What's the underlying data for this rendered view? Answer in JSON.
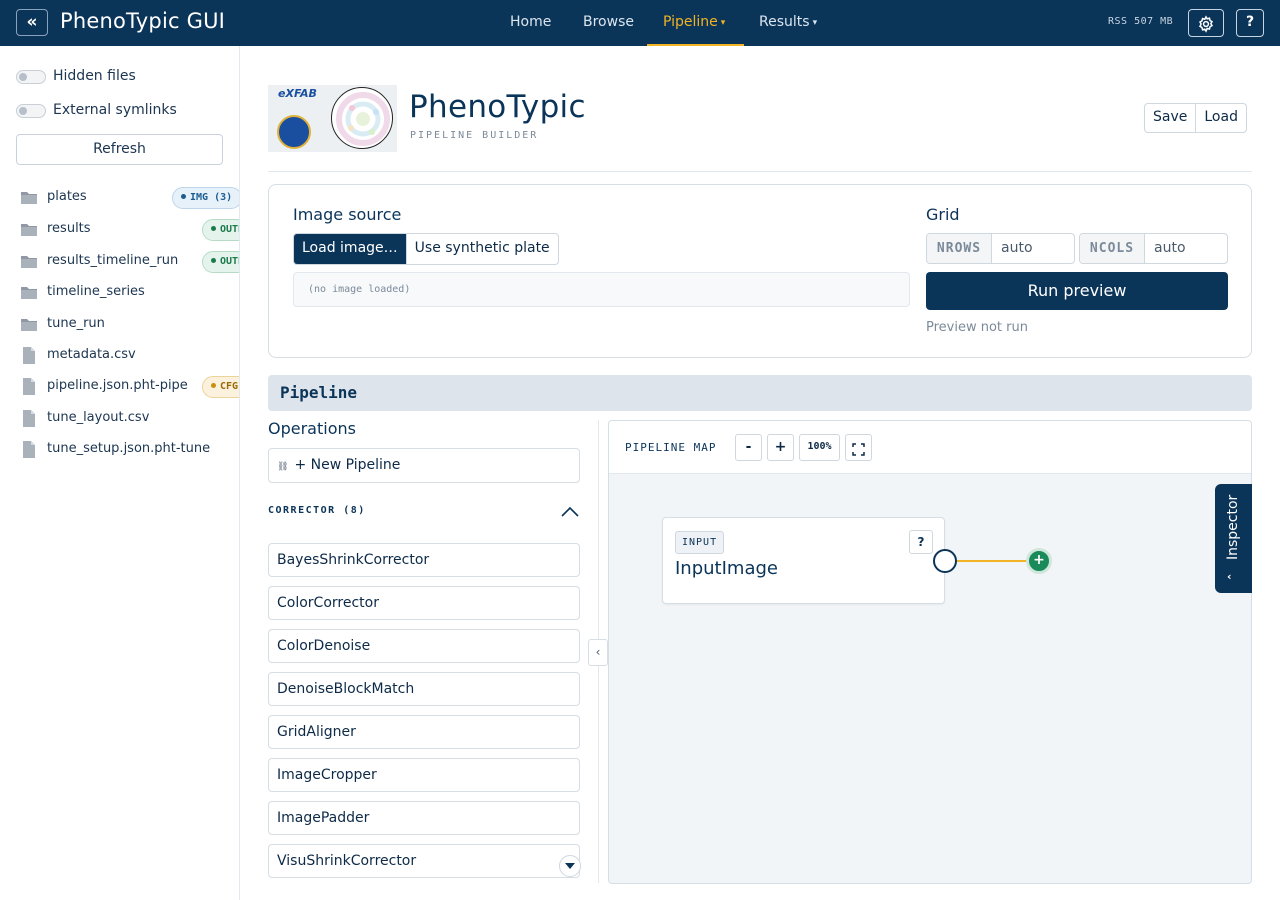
{
  "nav": {
    "app_title": "PhenoTypic GUI",
    "collapse_glyph": "«",
    "items": [
      {
        "label": "Home",
        "active": false,
        "dropdown": false
      },
      {
        "label": "Browse",
        "active": false,
        "dropdown": false
      },
      {
        "label": "Pipeline",
        "active": true,
        "dropdown": true
      },
      {
        "label": "Results",
        "active": false,
        "dropdown": true
      }
    ],
    "rss": "RSS 507 MB",
    "help_label": "?",
    "settings_icon": "gear-icon"
  },
  "sidebar": {
    "toggles": [
      {
        "label": "Hidden files",
        "on": false
      },
      {
        "label": "External symlinks",
        "on": false
      }
    ],
    "refresh_label": "Refresh",
    "files": [
      {
        "name": "plates",
        "type": "folder",
        "badge": "IMG (3)",
        "badge_kind": "img"
      },
      {
        "name": "results",
        "type": "folder",
        "badge": "OUTPUT",
        "badge_kind": "out"
      },
      {
        "name": "results_timeline_run",
        "type": "folder",
        "badge": "OUTPUT",
        "badge_kind": "out"
      },
      {
        "name": "timeline_series",
        "type": "folder"
      },
      {
        "name": "tune_run",
        "type": "folder"
      },
      {
        "name": "metadata.csv",
        "type": "file"
      },
      {
        "name": "pipeline.json.pht-pipe",
        "type": "file",
        "badge": "CFG",
        "badge_kind": "cfg"
      },
      {
        "name": "tune_layout.csv",
        "type": "file"
      },
      {
        "name": "tune_setup.json.pht-tune",
        "type": "file"
      }
    ]
  },
  "header": {
    "title": "PhenoTypic",
    "subtitle": "PIPELINE BUILDER",
    "logo_text": "eXFAB",
    "save_label": "Save",
    "load_label": "Load"
  },
  "source": {
    "image_source_label": "Image source",
    "load_image_label": "Load image…",
    "synthetic_label": "Use synthetic plate",
    "no_image_text": "(no image loaded)",
    "grid_label": "Grid",
    "nrows_label": "NROWS",
    "nrows_value": "auto",
    "ncols_label": "NCOLS",
    "ncols_value": "auto",
    "run_preview_label": "Run preview",
    "preview_status": "Preview not run"
  },
  "pipeline": {
    "section_title": "Pipeline",
    "operations_title": "Operations",
    "new_pipeline_label": "+ New Pipeline",
    "new_pipeline_icon": "⛓",
    "group_title": "CORRECTOR (8)",
    "operations": [
      "BayesShrinkCorrector",
      "ColorCorrector",
      "ColorDenoise",
      "DenoiseBlockMatch",
      "GridAligner",
      "ImageCropper",
      "ImagePadder",
      "VisuShrinkCorrector"
    ]
  },
  "map": {
    "label": "PIPELINE MAP",
    "zoom_out": "-",
    "zoom_in": "+",
    "zoom_level": "100%",
    "node_tag": "INPUT",
    "node_name": "InputImage",
    "node_help": "?",
    "add_glyph": "+",
    "inspector_label": "Inspector"
  },
  "colors": {
    "navy": "#0b3459",
    "accent": "#f2b324",
    "success": "#1a8a5a"
  }
}
